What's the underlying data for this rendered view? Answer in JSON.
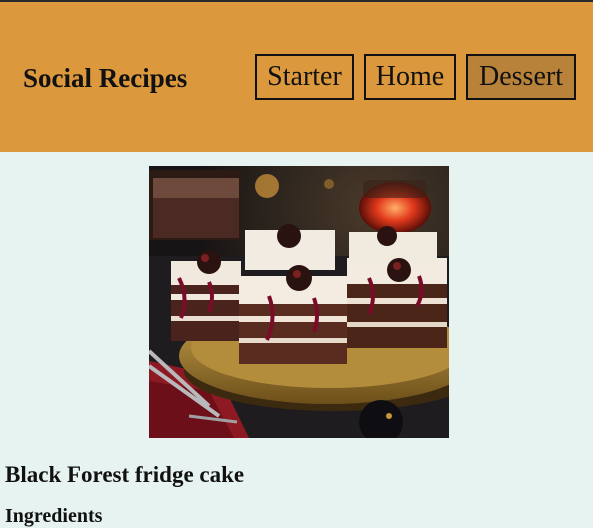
{
  "header": {
    "brand": "Social Recipes",
    "nav": [
      {
        "label": "Starter"
      },
      {
        "label": "Home"
      },
      {
        "label": "Dessert",
        "active": true
      }
    ],
    "background_color": "#db983c",
    "active_color": "#b9823a"
  },
  "recipe": {
    "title": "Black Forest fridge cake",
    "next_section": "Ingredients"
  },
  "colors": {
    "page_background": "#e7f3f1"
  }
}
